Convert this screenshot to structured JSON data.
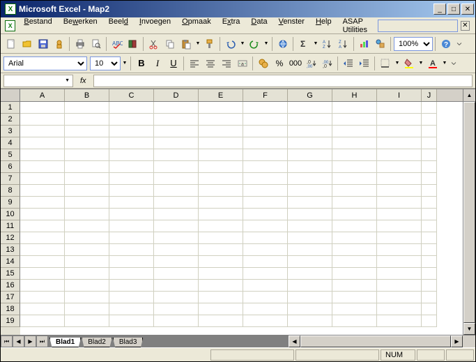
{
  "window": {
    "title": "Microsoft Excel - Map2"
  },
  "menu": {
    "items": [
      {
        "label": "Bestand",
        "u": 0
      },
      {
        "label": "Bewerken",
        "u": 2
      },
      {
        "label": "Beeld",
        "u": 4
      },
      {
        "label": "Invoegen",
        "u": 0
      },
      {
        "label": "Opmaak",
        "u": 0
      },
      {
        "label": "Extra",
        "u": 1
      },
      {
        "label": "Data",
        "u": 0
      },
      {
        "label": "Venster",
        "u": 0
      },
      {
        "label": "Help",
        "u": 0
      },
      {
        "label": "ASAP Utilities",
        "u": -1
      }
    ]
  },
  "toolbar1": {
    "zoom": "100%"
  },
  "toolbar2": {
    "font": "Arial",
    "size": "10"
  },
  "formulabar": {
    "namebox": "",
    "fx": "fx",
    "value": ""
  },
  "grid": {
    "columns": [
      "A",
      "B",
      "C",
      "D",
      "E",
      "F",
      "G",
      "H",
      "I",
      "J"
    ],
    "row_count": 19
  },
  "sheets": {
    "tabs": [
      "Blad1",
      "Blad2",
      "Blad3"
    ],
    "active": 0
  },
  "status": {
    "num": "NUM"
  }
}
